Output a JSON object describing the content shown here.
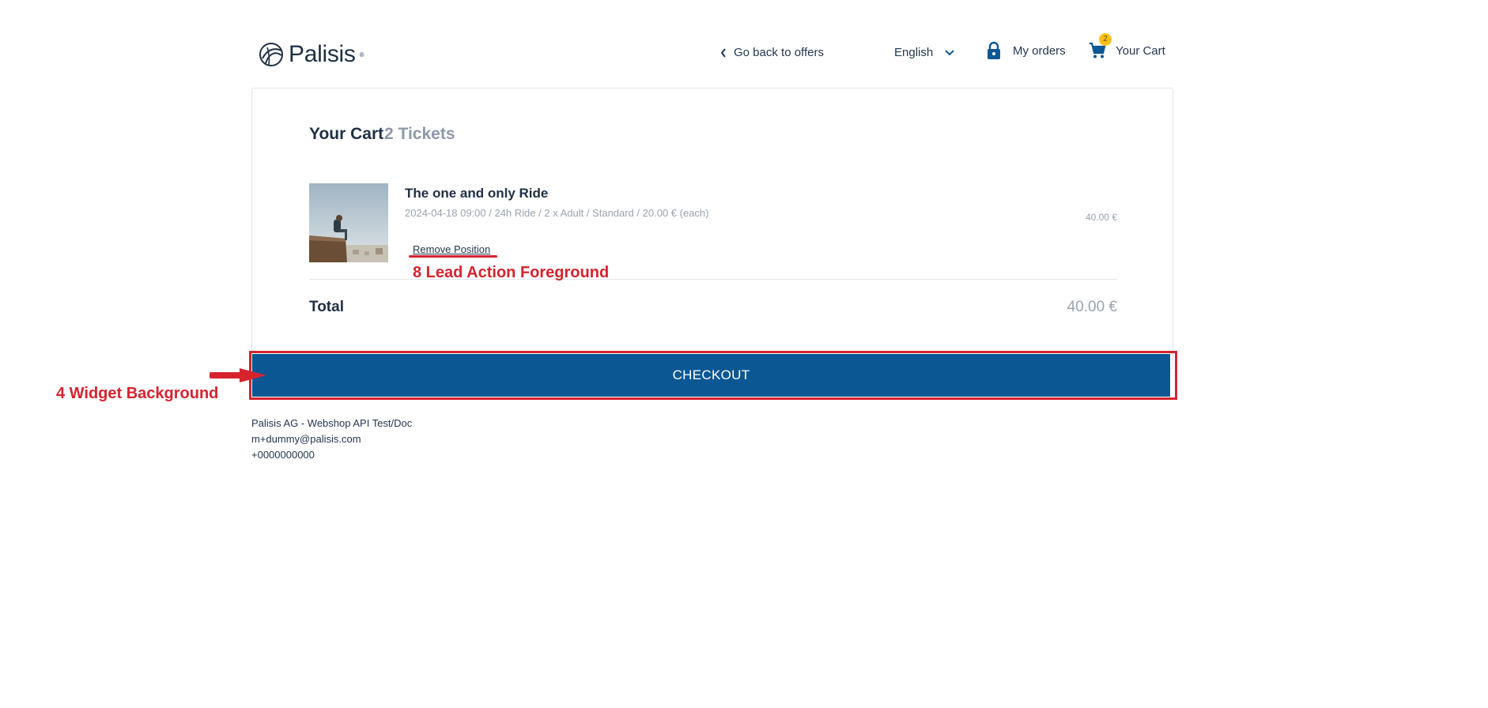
{
  "header": {
    "logo_text": "Palisis",
    "logo_reg": "®",
    "back_label": "Go back to offers",
    "language": "English",
    "orders_label": "My orders",
    "cart_label": "Your Cart",
    "cart_count": "2"
  },
  "cart": {
    "title": "Your Cart",
    "tickets": "2 Tickets",
    "items": [
      {
        "name": "The one and only Ride",
        "meta": "2024-04-18 09:00 / 24h Ride / 2 x Adult / Standard / 20.00 € (each)",
        "price": "40.00 €",
        "remove_label": "Remove Position"
      }
    ],
    "total_label": "Total",
    "total_value": "40.00 €",
    "checkout_label": "CHECKOUT"
  },
  "annotations": {
    "widget_background": "4 Widget Background",
    "lead_action": "8 Lead Action Foreground",
    "color": "#d6232e"
  },
  "footer": {
    "company": "Palisis AG - Webshop API Test/Doc",
    "email": "m+dummy@palisis.com",
    "phone": "+0000000000"
  },
  "colors": {
    "primary": "#0b5794",
    "badge": "#f6c21b",
    "text_dark": "#1f2f45",
    "text_muted": "#9aa3af"
  }
}
